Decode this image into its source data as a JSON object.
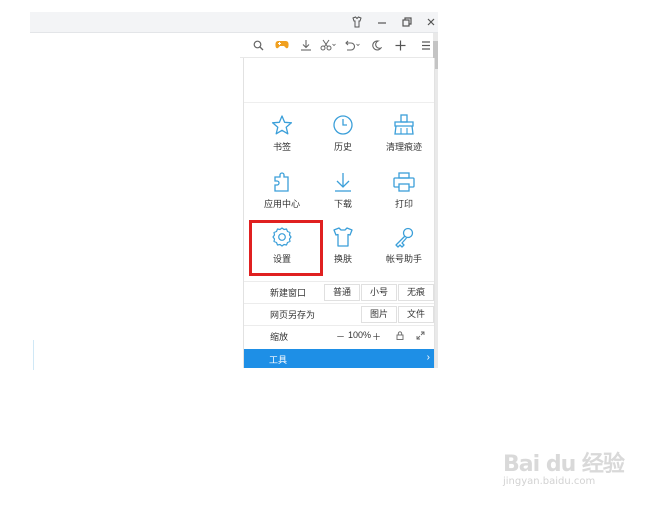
{
  "colors": {
    "accent": "#1e8fe6",
    "icon": "#3b9fd9",
    "highlight": "#e02020",
    "game_icon": "#f0a020"
  },
  "titlebar": {
    "icons": [
      "shirt-icon",
      "minimize-icon",
      "restore-icon",
      "close-icon"
    ]
  },
  "toolbar": {
    "icons": [
      "search-icon",
      "game-icon",
      "download-icon",
      "scissors-icon",
      "undo-icon",
      "moon-icon",
      "plus-icon",
      "menu-icon"
    ]
  },
  "menu": {
    "grid": [
      {
        "label": "书签",
        "icon": "star-icon"
      },
      {
        "label": "历史",
        "icon": "clock-icon"
      },
      {
        "label": "清理痕迹",
        "icon": "broom-icon"
      },
      {
        "label": "应用中心",
        "icon": "puzzle-icon"
      },
      {
        "label": "下载",
        "icon": "download-icon"
      },
      {
        "label": "打印",
        "icon": "printer-icon"
      },
      {
        "label": "设置",
        "icon": "gear-icon"
      },
      {
        "label": "换肤",
        "icon": "tshirt-icon"
      },
      {
        "label": "帐号助手",
        "icon": "key-icon"
      }
    ],
    "new_window": {
      "label": "新建窗口",
      "options": [
        "普通",
        "小号",
        "无痕"
      ]
    },
    "save_page": {
      "label": "网页另存为",
      "options": [
        "图片",
        "文件"
      ]
    },
    "zoom": {
      "label": "缩放",
      "minus": "－",
      "value": "100%",
      "plus": "＋"
    },
    "tools": {
      "label": "工具",
      "arrow": "›"
    }
  },
  "watermark": {
    "brand": "Bai du 经验",
    "url": "jingyan.baidu.com"
  }
}
